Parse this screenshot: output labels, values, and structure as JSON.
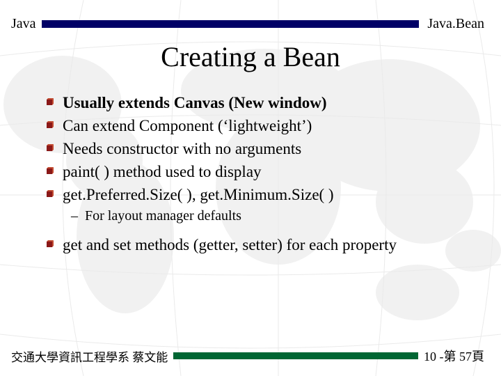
{
  "header": {
    "left": "Java",
    "right": "Java.Bean"
  },
  "title": "Creating a Bean",
  "bullets": [
    {
      "level": 1,
      "text": "Usually extends Canvas (New window)",
      "bold": true
    },
    {
      "level": 1,
      "text": "Can extend Component (‘lightweight’)"
    },
    {
      "level": 1,
      "text": "Needs constructor with no arguments"
    },
    {
      "level": 1,
      "text": "paint( ) method used to display"
    },
    {
      "level": 1,
      "text": "get.Preferred.Size( ), get.Minimum.Size( )"
    },
    {
      "level": 2,
      "text": "For layout manager defaults"
    },
    {
      "level": 1,
      "text": "get and set methods (getter, setter) for each property",
      "gapBefore": true
    }
  ],
  "footer": {
    "left": "交通大學資訊工程學系 蔡文能",
    "right": "10 -第 57頁"
  },
  "colors": {
    "header_rule": "#000066",
    "footer_rule": "#006633",
    "bullet_dark": "#8a1818",
    "bullet_light": "#c24a30"
  }
}
